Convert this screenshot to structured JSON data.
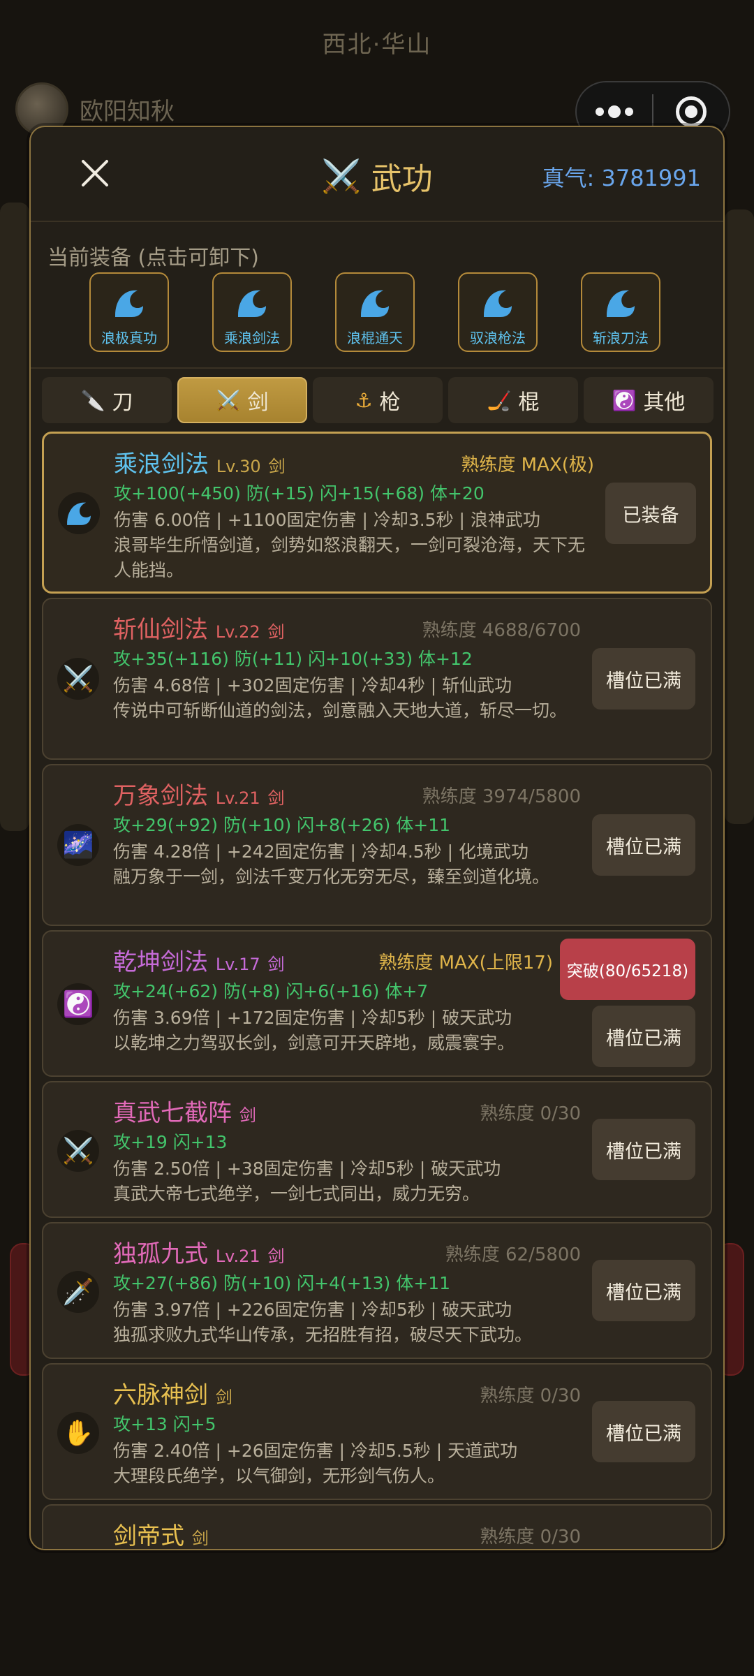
{
  "background": {
    "location_title": "西北·华山",
    "player_name": "欧阳知秋"
  },
  "modal": {
    "title": "武功",
    "title_icon": "crossed-swords-icon",
    "energy_label": "真气: 3781991",
    "equip_label": "当前装备 (点击可卸下)",
    "equipped": [
      {
        "name": "浪极真功",
        "icon": "wave-icon"
      },
      {
        "name": "乘浪剑法",
        "icon": "wave-icon"
      },
      {
        "name": "浪棍通天",
        "icon": "wave-icon"
      },
      {
        "name": "驭浪枪法",
        "icon": "wave-icon"
      },
      {
        "name": "斩浪刀法",
        "icon": "wave-icon"
      }
    ],
    "tabs": [
      {
        "label": "刀",
        "icon": "knife-icon",
        "active": false
      },
      {
        "label": "剑",
        "icon": "sword-icon",
        "active": true
      },
      {
        "label": "枪",
        "icon": "anchor-icon",
        "active": false
      },
      {
        "label": "棍",
        "icon": "staff-icon",
        "active": false
      },
      {
        "label": "其他",
        "icon": "yin-yang-icon",
        "active": false
      }
    ],
    "skills": [
      {
        "name": "乘浪剑法",
        "level": "Lv.30",
        "type": "剑",
        "proficiency": "熟练度 MAX(极)",
        "stats": "攻+100(+450) 防(+15) 闪+15(+68) 体+20",
        "desc1": "伤害 6.00倍 | +1100固定伤害 | 冷却3.5秒 | 浪神武功",
        "desc2": "浪哥毕生所悟剑道，剑势如怒浪翻天，一剑可裂沧海，天下无人能挡。",
        "action": "已装备"
      },
      {
        "name": "斩仙剑法",
        "level": "Lv.22",
        "type": "剑",
        "proficiency": "熟练度 4688/6700",
        "stats": "攻+35(+116) 防(+11) 闪+10(+33) 体+12",
        "desc1": "伤害 4.68倍 | +302固定伤害 | 冷却4秒 | 斩仙武功",
        "desc2": "传说中可斩断仙道的剑法，剑意融入天地大道，斩尽一切。",
        "action": "槽位已满"
      },
      {
        "name": "万象剑法",
        "level": "Lv.21",
        "type": "剑",
        "proficiency": "熟练度 3974/5800",
        "stats": "攻+29(+92) 防(+10) 闪+8(+26) 体+11",
        "desc1": "伤害 4.28倍 | +242固定伤害 | 冷却4.5秒 | 化境武功",
        "desc2": "融万象于一剑，剑法千变万化无穷无尽，臻至剑道化境。",
        "action": "槽位已满"
      },
      {
        "name": "乾坤剑法",
        "level": "Lv.17",
        "type": "剑",
        "proficiency": "熟练度 MAX(上限17)",
        "stats": "攻+24(+62) 防(+8) 闪+6(+16) 体+7",
        "desc1": "伤害 3.69倍 | +172固定伤害 | 冷却5秒 | 破天武功",
        "desc2": "以乾坤之力驾驭长剑，剑意可开天辟地，威震寰宇。",
        "action": "槽位已满",
        "break_label": "突破(80/65218)"
      },
      {
        "name": "真武七截阵",
        "level": "",
        "type": "剑",
        "proficiency": "熟练度 0/30",
        "stats": "攻+19 闪+13",
        "desc1": "伤害 2.50倍 | +38固定伤害 | 冷却5秒 | 破天武功",
        "desc2": "真武大帝七式绝学，一剑七式同出，威力无穷。",
        "action": "槽位已满"
      },
      {
        "name": "独孤九式",
        "level": "Lv.21",
        "type": "剑",
        "proficiency": "熟练度 62/5800",
        "stats": "攻+27(+86) 防(+10) 闪+4(+13) 体+11",
        "desc1": "伤害 3.97倍 | +226固定伤害 | 冷却5秒 | 破天武功",
        "desc2": "独孤求败九式华山传承，无招胜有招，破尽天下武功。",
        "action": "槽位已满"
      },
      {
        "name": "六脉神剑",
        "level": "",
        "type": "剑",
        "proficiency": "熟练度 0/30",
        "stats": "攻+13 闪+5",
        "desc1": "伤害 2.40倍 | +26固定伤害 | 冷却5.5秒 | 天道武功",
        "desc2": "大理段氏绝学，以气御剑，无形剑气伤人。",
        "action": "槽位已满"
      },
      {
        "name": "剑帝式",
        "level": "",
        "type": "剑",
        "proficiency": "熟练度 0/30"
      }
    ]
  }
}
